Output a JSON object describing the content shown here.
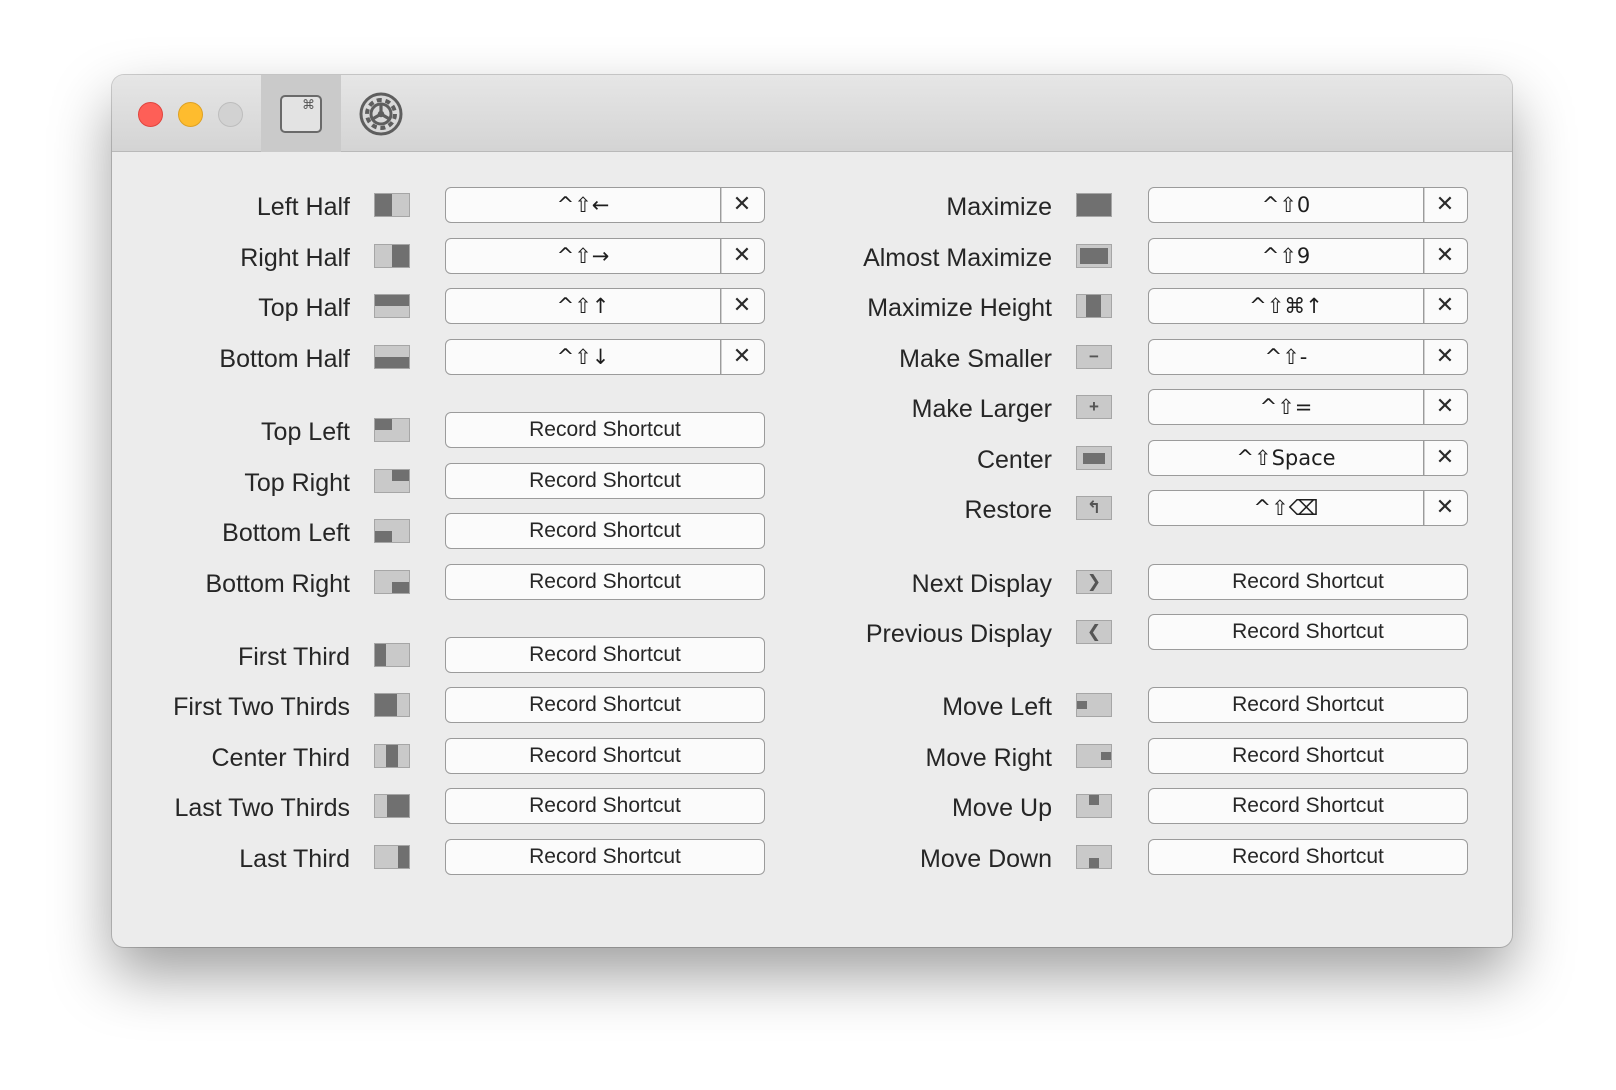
{
  "colors": {
    "close": "#fe5f57",
    "minimize": "#febc2e",
    "zoom": "#d2d2d2"
  },
  "toolbar": {
    "shortcuts_tab_icon": "command-key-icon",
    "shortcuts_tab_glyph": "⌘",
    "settings_tab_icon": "gear-icon"
  },
  "left_column": [
    {
      "id": "left-half",
      "label": "Left Half",
      "icon": "left-half-icon",
      "shortcut": "^⇧←",
      "clear": "✕"
    },
    {
      "id": "right-half",
      "label": "Right Half",
      "icon": "right-half-icon",
      "shortcut": "^⇧→",
      "clear": "✕"
    },
    {
      "id": "top-half",
      "label": "Top Half",
      "icon": "top-half-icon",
      "shortcut": "^⇧↑",
      "clear": "✕"
    },
    {
      "id": "bottom-half",
      "label": "Bottom Half",
      "icon": "bottom-half-icon",
      "shortcut": "^⇧↓",
      "clear": "✕"
    },
    {
      "id": "top-left",
      "label": "Top Left",
      "icon": "top-left-icon",
      "record": "Record Shortcut"
    },
    {
      "id": "top-right",
      "label": "Top Right",
      "icon": "top-right-icon",
      "record": "Record Shortcut"
    },
    {
      "id": "bottom-left",
      "label": "Bottom Left",
      "icon": "bottom-left-icon",
      "record": "Record Shortcut"
    },
    {
      "id": "bottom-right",
      "label": "Bottom Right",
      "icon": "bottom-right-icon",
      "record": "Record Shortcut"
    },
    {
      "id": "first-third",
      "label": "First Third",
      "icon": "first-third-icon",
      "record": "Record Shortcut"
    },
    {
      "id": "first-two-thirds",
      "label": "First Two Thirds",
      "icon": "first-two-thirds-icon",
      "record": "Record Shortcut"
    },
    {
      "id": "center-third",
      "label": "Center Third",
      "icon": "center-third-icon",
      "record": "Record Shortcut"
    },
    {
      "id": "last-two-thirds",
      "label": "Last Two Thirds",
      "icon": "last-two-thirds-icon",
      "record": "Record Shortcut"
    },
    {
      "id": "last-third",
      "label": "Last Third",
      "icon": "last-third-icon",
      "record": "Record Shortcut"
    }
  ],
  "right_column": [
    {
      "id": "maximize",
      "label": "Maximize",
      "icon": "maximize-icon",
      "shortcut": "^⇧0",
      "clear": "✕"
    },
    {
      "id": "almost-maximize",
      "label": "Almost Maximize",
      "icon": "almost-maximize-icon",
      "shortcut": "^⇧9",
      "clear": "✕"
    },
    {
      "id": "maximize-height",
      "label": "Maximize Height",
      "icon": "maximize-height-icon",
      "shortcut": "^⇧⌘↑",
      "clear": "✕"
    },
    {
      "id": "make-smaller",
      "label": "Make Smaller",
      "icon": "minus-icon",
      "icon_glyph": "−",
      "shortcut": "^⇧-",
      "clear": "✕"
    },
    {
      "id": "make-larger",
      "label": "Make Larger",
      "icon": "plus-icon",
      "icon_glyph": "+",
      "shortcut": "^⇧=",
      "clear": "✕"
    },
    {
      "id": "center",
      "label": "Center",
      "icon": "center-icon",
      "shortcut": "^⇧Space",
      "clear": "✕"
    },
    {
      "id": "restore",
      "label": "Restore",
      "icon": "restore-icon",
      "icon_glyph": "↰",
      "shortcut": "^⇧⌫",
      "clear": "✕"
    },
    {
      "id": "next-display",
      "label": "Next Display",
      "icon": "next-display-icon",
      "icon_glyph": "❯",
      "record": "Record Shortcut"
    },
    {
      "id": "previous-display",
      "label": "Previous Display",
      "icon": "previous-display-icon",
      "icon_glyph": "❮",
      "record": "Record Shortcut"
    },
    {
      "id": "move-left",
      "label": "Move Left",
      "icon": "move-left-icon",
      "record": "Record Shortcut"
    },
    {
      "id": "move-right",
      "label": "Move Right",
      "icon": "move-right-icon",
      "record": "Record Shortcut"
    },
    {
      "id": "move-up",
      "label": "Move Up",
      "icon": "move-up-icon",
      "record": "Record Shortcut"
    },
    {
      "id": "move-down",
      "label": "Move Down",
      "icon": "move-down-icon",
      "record": "Record Shortcut"
    }
  ]
}
